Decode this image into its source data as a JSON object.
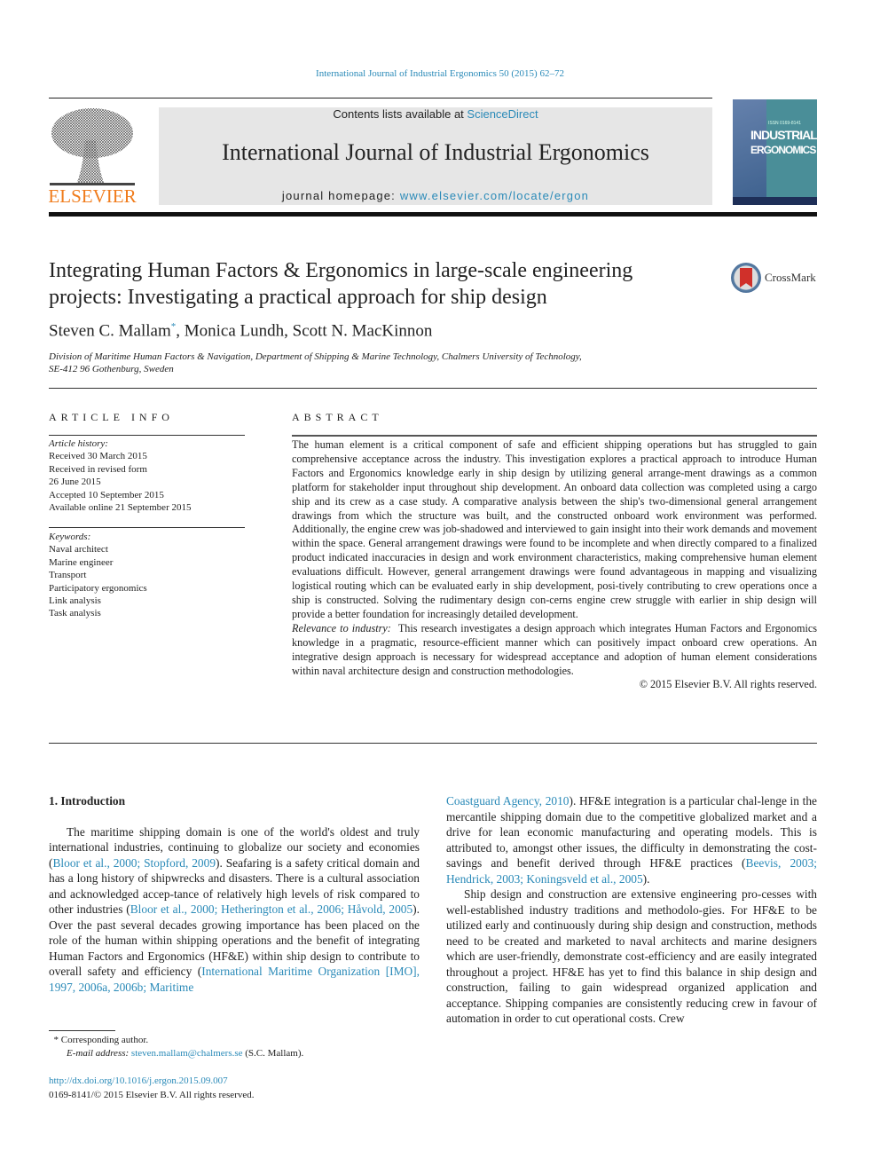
{
  "header": {
    "journal_ref": "International Journal of Industrial Ergonomics 50 (2015) 62–72",
    "contents_prefix": "Contents lists available at ",
    "contents_link": "ScienceDirect",
    "journal_title": "International Journal of Industrial Ergonomics",
    "homepage_prefix": "journal homepage: ",
    "homepage_link": "www.elsevier.com/locate/ergon",
    "publisher_logo_text": "ELSEVIER",
    "cover": {
      "line1": "INDUSTRIAL",
      "line2": "ERGONOMICS",
      "issn": "ISSN 0169-8141"
    },
    "colors": {
      "link": "#2a8ab8",
      "elsevier_orange": "#f07c1c",
      "cover_teal": "#4a8e98",
      "banner_gray": "#e6e6e6"
    }
  },
  "article": {
    "title": "Integrating Human Factors & Ergonomics in large-scale engineering projects: Investigating a practical approach for ship design",
    "crossmark_label": "CrossMark",
    "authors": {
      "first": "Steven C. Mallam",
      "first_mark": "*",
      "rest": ", Monica Lundh, Scott N. MacKinnon"
    },
    "affiliation_line1": "Division of Maritime Human Factors & Navigation, Department of Shipping & Marine Technology, Chalmers University of Technology,",
    "affiliation_line2": "SE-412 96 Gothenburg, Sweden"
  },
  "article_info": {
    "heading": "ARTICLE INFO",
    "history_label": "Article history:",
    "history": [
      "Received 30 March 2015",
      "Received in revised form",
      "26 June 2015",
      "Accepted 10 September 2015",
      "Available online 21 September 2015"
    ],
    "keywords_label": "Keywords:",
    "keywords": [
      "Naval architect",
      "Marine engineer",
      "Transport",
      "Participatory ergonomics",
      "Link analysis",
      "Task analysis"
    ]
  },
  "abstract": {
    "heading": "ABSTRACT",
    "body": "The human element is a critical component of safe and efficient shipping operations but has struggled to gain comprehensive acceptance across the industry. This investigation explores a practical approach to introduce Human Factors and Ergonomics knowledge early in ship design by utilizing general arrange-ment drawings as a common platform for stakeholder input throughout ship development. An onboard data collection was completed using a cargo ship and its crew as a case study. A comparative analysis between the ship's two-dimensional general arrangement drawings from which the structure was built, and the constructed onboard work environment was performed. Additionally, the engine crew was job-shadowed and interviewed to gain insight into their work demands and movement within the space. General arrangement drawings were found to be incomplete and when directly compared to a finalized product indicated inaccuracies in design and work environment characteristics, making comprehensive human element evaluations difficult. However, general arrangement drawings were found advantageous in mapping and visualizing logistical routing which can be evaluated early in ship development, posi-tively contributing to crew operations once a ship is constructed. Solving the rudimentary design con-cerns engine crew struggle with earlier in ship design will provide a better foundation for increasingly detailed development.",
    "relevance_label": "Relevance to industry:",
    "relevance_body": "This research investigates a design approach which integrates Human Factors and Ergonomics knowledge in a pragmatic, resource-efficient manner which can positively impact onboard crew operations. An integrative design approach is necessary for widespread acceptance and adoption of human element considerations within naval architecture design and construction methodologies.",
    "copyright": "© 2015 Elsevier B.V. All rights reserved."
  },
  "introduction": {
    "heading": "1.  Introduction",
    "p1": [
      {
        "t": "The maritime shipping domain is one of the world's oldest and truly international industries, continuing to globalize our society and economies ("
      },
      {
        "t": "Bloor et al., 2000; Stopford, 2009",
        "link": true
      },
      {
        "t": "). Seafaring is a safety critical domain and has a long history of shipwrecks and disasters. There is a cultural association and acknowledged accep-tance of relatively high levels of risk compared to other industries ("
      },
      {
        "t": "Bloor et al., 2000; Hetherington et al., 2006; Håvold, 2005",
        "link": true
      },
      {
        "t": "). Over the past several decades growing importance has been placed on the role of the human within shipping operations and the benefit of integrating Human Factors and Ergonomics (HF&E) within ship design to contribute to overall safety and efficiency ("
      },
      {
        "t": "International Maritime Organization [IMO], 1997, 2006a, 2006b; Maritime",
        "link": true
      }
    ],
    "p1_cont": [
      {
        "t": "Coastguard Agency, 2010",
        "link": true
      },
      {
        "t": "). HF&E integration is a particular chal-lenge in the mercantile shipping domain due to the competitive globalized market and a drive for lean economic manufacturing and operating models. This is attributed to, amongst other issues, the difficulty in demonstrating the cost-savings and benefit derived through HF&E practices ("
      },
      {
        "t": "Beevis, 2003; Hendrick, 2003; Koningsveld et al., 2005",
        "link": true
      },
      {
        "t": ")."
      }
    ],
    "p2": "Ship design and construction are extensive engineering pro-cesses with well-established industry traditions and methodolo-gies. For HF&E to be utilized early and continuously during ship design and construction, methods need to be created and marketed to naval architects and marine designers which are user-friendly, demonstrate cost-efficiency and are easily integrated throughout a project. HF&E has yet to find this balance in ship design and construction, failing to gain widespread organized application and acceptance. Shipping companies are consistently reducing crew in favour of automation in order to cut operational costs. Crew"
  },
  "footnote": {
    "mark": "*",
    "corresponding": " Corresponding author.",
    "email_label": "E-mail address: ",
    "email": "steven.mallam@chalmers.se",
    "email_suffix": " (S.C. Mallam)."
  },
  "doi": {
    "link": "http://dx.doi.org/10.1016/j.ergon.2015.09.007",
    "rights": "0169-8141/© 2015 Elsevier B.V. All rights reserved."
  }
}
